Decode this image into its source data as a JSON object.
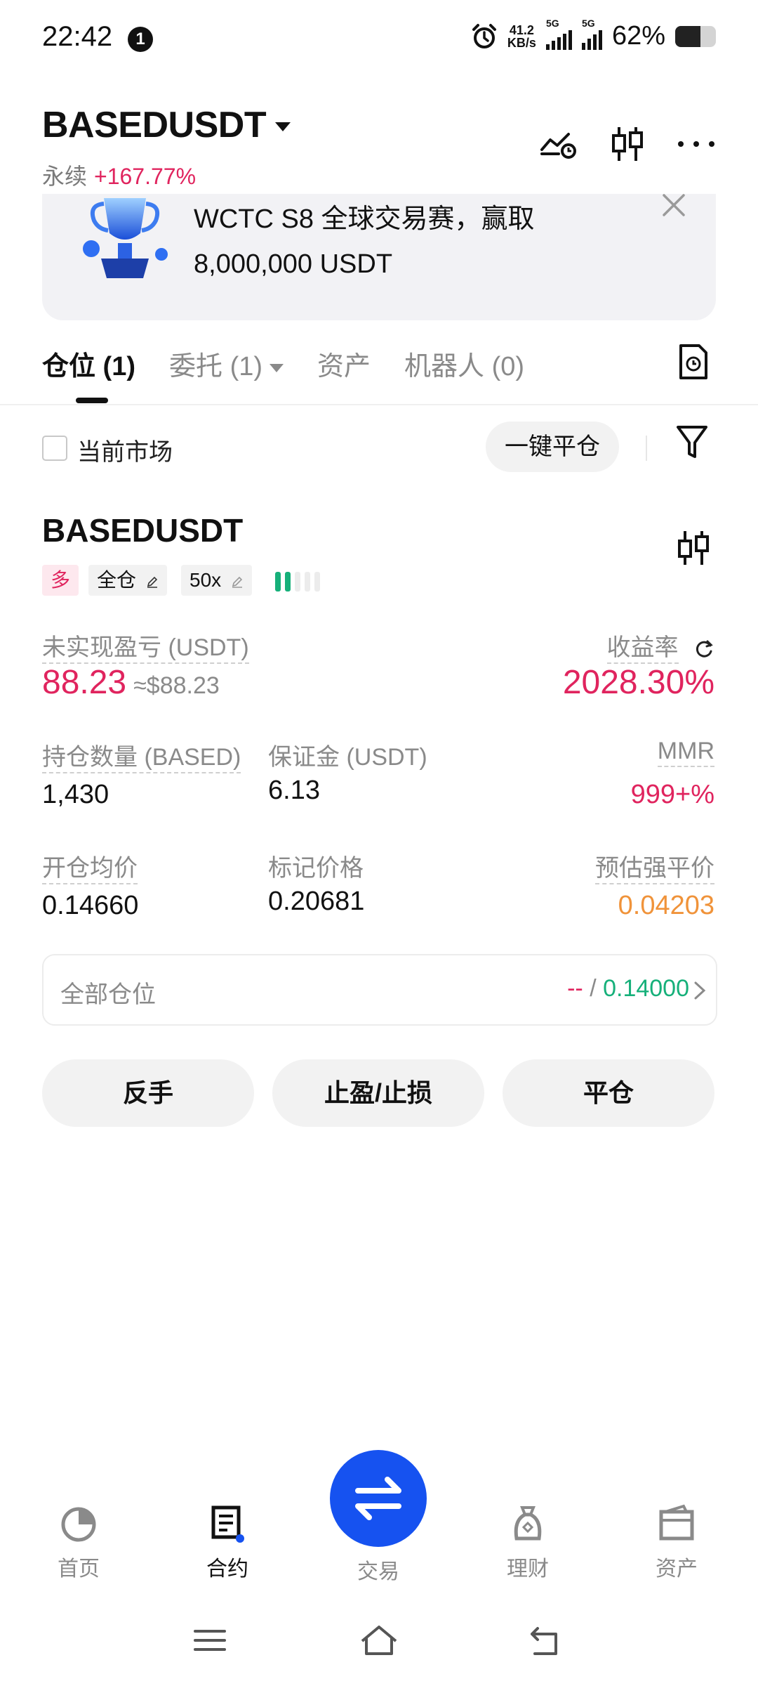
{
  "status_bar": {
    "time": "22:42",
    "notif_count": "1",
    "net_speed_value": "41.2",
    "net_speed_unit": "KB/s",
    "sig1_label": "5G",
    "sig2_label": "5G",
    "battery_text": "62%",
    "battery_level": 0.62
  },
  "header": {
    "symbol": "BASEDUSDT",
    "type_label": "永续",
    "change_pct": "+167.77%"
  },
  "banner": {
    "line1": "WCTC S8 全球交易赛，赢取",
    "line2": "8,000,000 USDT"
  },
  "tabs": {
    "positions": "仓位 (1)",
    "orders": "委托 (1)",
    "assets": "资产",
    "bots": "机器人 (0)"
  },
  "filter": {
    "current_market_label": "当前市场",
    "close_all_label": "一键平仓"
  },
  "position": {
    "symbol": "BASEDUSDT",
    "side_tag": "多",
    "margin_mode": "全仓",
    "leverage": "50x",
    "adl_level": 2,
    "unrealized_pnl_label": "未实现盈亏 (USDT)",
    "unrealized_pnl": "88.23",
    "unrealized_pnl_approx": "≈$88.23",
    "roe_label": "收益率",
    "roe": "2028.30%",
    "size_label": "持仓数量 (BASED)",
    "size": "1,430",
    "margin_label": "保证金 (USDT)",
    "margin": "6.13",
    "mmr_label": "MMR",
    "mmr": "999+%",
    "entry_label": "开仓均价",
    "entry": "0.14660",
    "mark_label": "标记价格",
    "mark": "0.20681",
    "liq_label": "预估强平价",
    "liq": "0.04203"
  },
  "all_positions": {
    "label": "全部仓位",
    "tp": "--",
    "sep": " / ",
    "sl": "0.14000"
  },
  "actions": {
    "reverse": "反手",
    "tpsl": "止盈/止损",
    "close": "平仓"
  },
  "bottom_nav": {
    "home": "首页",
    "futures": "合约",
    "trade": "交易",
    "earn": "理财",
    "assets": "资产"
  },
  "colors": {
    "red": "#e0245e",
    "green": "#16b07a",
    "orange": "#f0933a",
    "blue": "#1652f0"
  }
}
